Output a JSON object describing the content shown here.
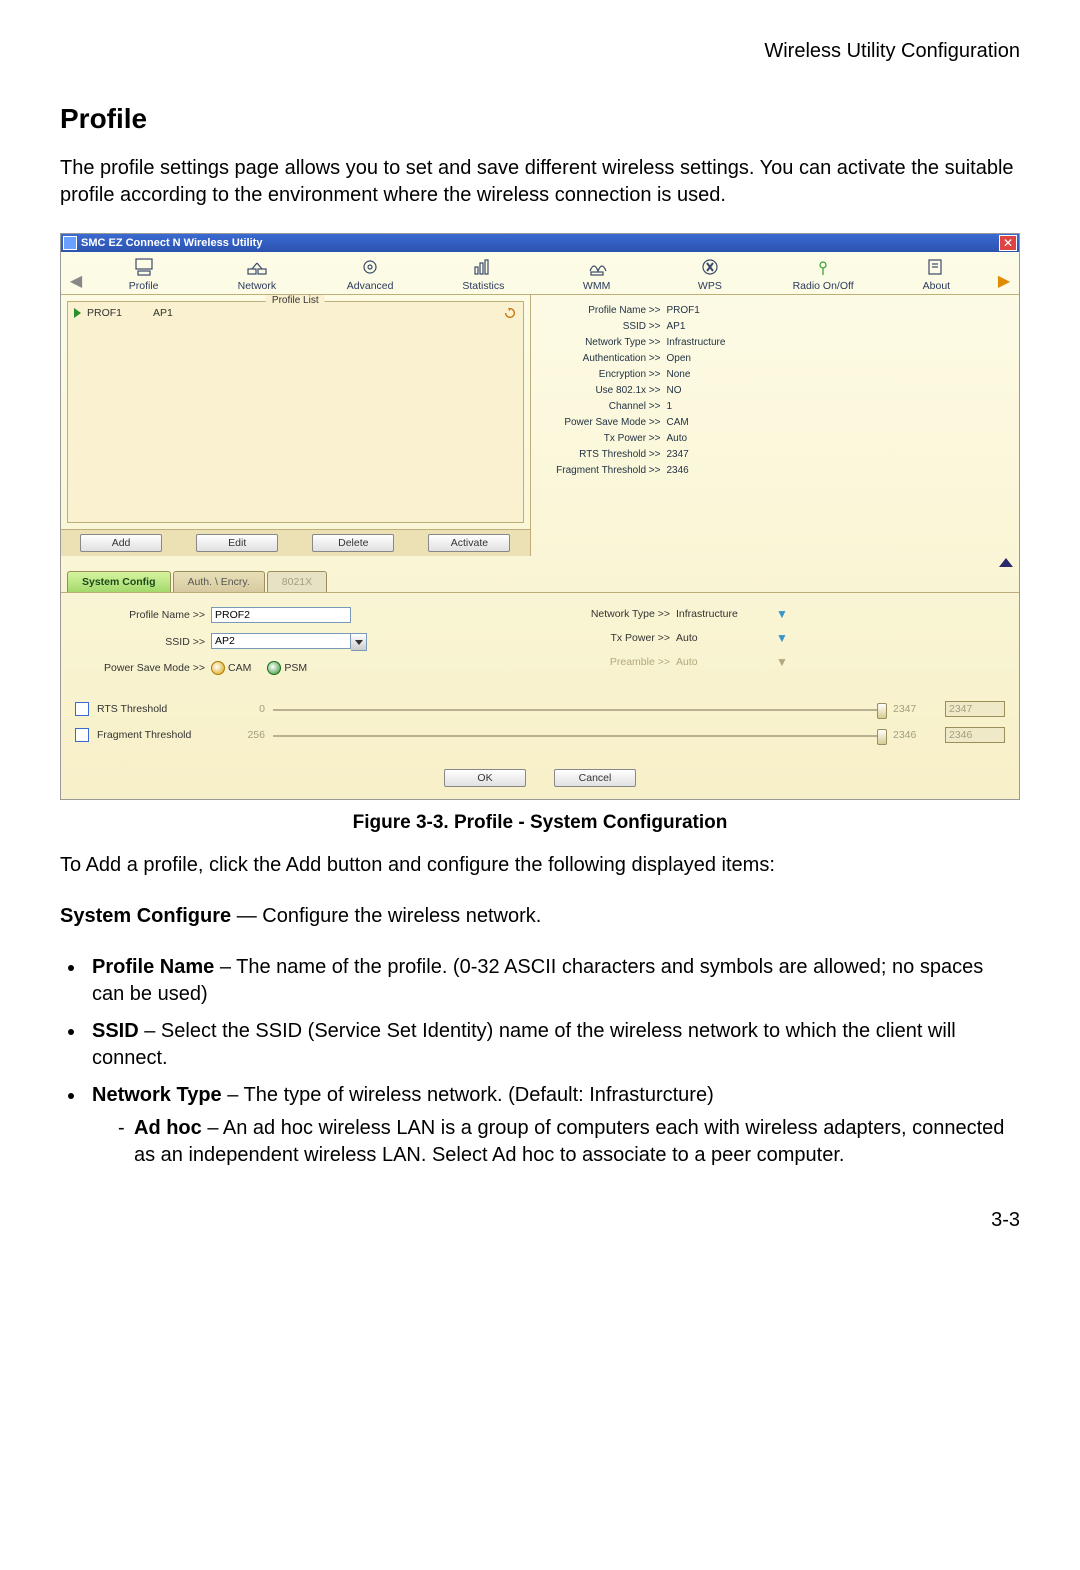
{
  "page": {
    "header_right": "Wireless Utility Configuration",
    "section_heading": "Profile",
    "intro": "The profile settings page allows you to set and save different wireless settings. You can activate the suitable profile according to the environment where the wireless connection is used.",
    "figure_caption": "Figure 3-3.  Profile - System Configuration",
    "after_figure": "To Add a profile, click the Add button and configure the following displayed items:",
    "sysconf_line_bold": "System Configure",
    "sysconf_line_rest": " — Configure the wireless network.",
    "bullets": [
      {
        "bold": "Profile Name",
        "rest": " – The name of the profile. (0-32 ASCII characters and symbols are allowed; no spaces can be used)"
      },
      {
        "bold": "SSID",
        "rest": " – Select the SSID (Service Set Identity) name of the wireless network to which the client will connect."
      },
      {
        "bold": "Network Type",
        "rest": " – The type of wireless network. (Default: Infrasturcture)",
        "sub": [
          {
            "bold": "Ad hoc",
            "rest": " – An ad hoc wireless LAN is a group of computers each with wireless adapters, connected as an independent wireless LAN. Select Ad hoc to associate to a peer computer."
          }
        ]
      }
    ],
    "pagenum": "3-3"
  },
  "app": {
    "title": "SMC EZ Connect N Wireless Utility",
    "toolbar": [
      "Profile",
      "Network",
      "Advanced",
      "Statistics",
      "WMM",
      "WPS",
      "Radio On/Off",
      "About"
    ],
    "profile_list": {
      "legend": "Profile List",
      "rows": [
        {
          "name": "PROF1",
          "ssid": "AP1"
        }
      ],
      "buttons": [
        "Add",
        "Edit",
        "Delete",
        "Activate"
      ]
    },
    "details": [
      {
        "k": "Profile Name >>",
        "v": "PROF1"
      },
      {
        "k": "SSID >>",
        "v": "AP1"
      },
      {
        "k": "Network Type >>",
        "v": "Infrastructure"
      },
      {
        "k": "Authentication >>",
        "v": "Open"
      },
      {
        "k": "Encryption >>",
        "v": "None"
      },
      {
        "k": "Use 802.1x >>",
        "v": "NO"
      },
      {
        "k": "Channel >>",
        "v": "1"
      },
      {
        "k": "Power Save Mode >>",
        "v": "CAM"
      },
      {
        "k": "Tx Power >>",
        "v": "Auto"
      },
      {
        "k": "RTS Threshold >>",
        "v": "2347"
      },
      {
        "k": "Fragment Threshold >>",
        "v": "2346"
      }
    ],
    "tabs": [
      "System Config",
      "Auth. \\ Encry.",
      "8021X"
    ],
    "form": {
      "profile_name_label": "Profile Name >>",
      "profile_name_value": "PROF2",
      "ssid_label": "SSID >>",
      "ssid_value": "AP2",
      "psm_label": "Power Save Mode >>",
      "psm_cam": "CAM",
      "psm_psm": "PSM",
      "net_type_label": "Network Type >>",
      "net_type_value": "Infrastructure",
      "tx_label": "Tx Power >>",
      "tx_value": "Auto",
      "preamble_label": "Preamble >>",
      "preamble_value": "Auto",
      "rts_label": "RTS Threshold",
      "rts_min": "0",
      "rts_max": "2347",
      "rts_value": "2347",
      "frag_label": "Fragment Threshold",
      "frag_min": "256",
      "frag_max": "2346",
      "frag_value": "2346",
      "ok": "OK",
      "cancel": "Cancel"
    }
  }
}
